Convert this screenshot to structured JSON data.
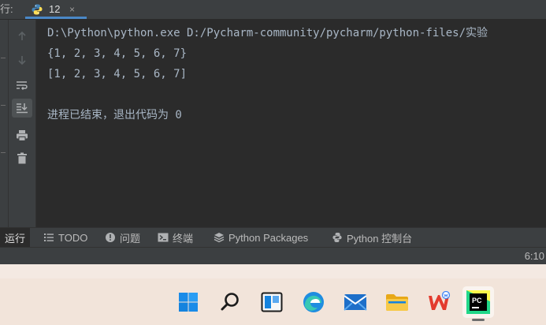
{
  "top": {
    "run_label": "行:",
    "tab": {
      "label": "12",
      "icon": "python-file-icon",
      "close": "×"
    }
  },
  "toolbar": {
    "items": [
      {
        "name": "scroll-up-icon",
        "state": "disabled"
      },
      {
        "name": "scroll-down-icon",
        "state": "disabled"
      },
      {
        "name": "soft-wrap-icon",
        "state": "normal"
      },
      {
        "name": "scroll-to-end-icon",
        "state": "active"
      },
      {
        "name": "print-icon",
        "state": "normal"
      },
      {
        "name": "trash-icon",
        "state": "normal"
      }
    ]
  },
  "console": {
    "lines": [
      "D:\\Python\\python.exe D:/Pycharm-community/pycharm/python-files/实验",
      "{1, 2, 3, 4, 5, 6, 7}",
      "[1, 2, 3, 4, 5, 6, 7]",
      "",
      "进程已结束，退出代码为 0"
    ]
  },
  "bottom_tabs": [
    {
      "label": "运行",
      "icon": "",
      "active": true
    },
    {
      "label": "TODO",
      "icon": "list-icon",
      "active": false
    },
    {
      "label": "问题",
      "icon": "problems-icon",
      "active": false
    },
    {
      "label": "终端",
      "icon": "terminal-icon",
      "active": false
    },
    {
      "label": "Python Packages",
      "icon": "packages-icon",
      "active": false
    },
    {
      "label": "Python 控制台",
      "icon": "python-console-icon",
      "active": false
    }
  ],
  "status": {
    "time": "6:10"
  },
  "taskbar": {
    "items": [
      {
        "name": "windows-start-icon",
        "active": false
      },
      {
        "name": "search-icon",
        "active": false
      },
      {
        "name": "task-view-icon",
        "active": false
      },
      {
        "name": "edge-browser-icon",
        "active": false
      },
      {
        "name": "mail-icon",
        "active": false
      },
      {
        "name": "file-explorer-icon",
        "active": false
      },
      {
        "name": "wps-office-icon",
        "active": false
      },
      {
        "name": "pycharm-icon",
        "active": true
      }
    ],
    "pycharm_label": "PC"
  },
  "colors": {
    "ide_background": "#2b2b2b",
    "panel": "#3c3f41",
    "console_text": "#a9b7c6",
    "tab_underline": "#4a88c7",
    "taskbar": "#f2e4da"
  }
}
